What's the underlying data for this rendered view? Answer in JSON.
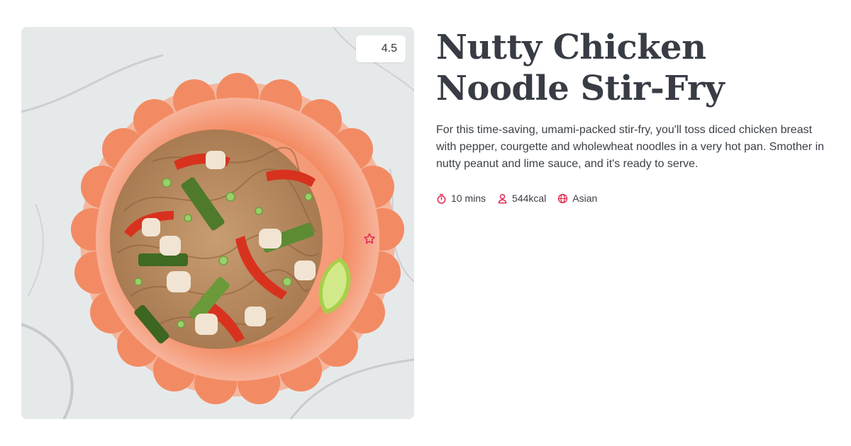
{
  "recipe": {
    "title": "Nutty Chicken Noodle Stir-Fry",
    "description": "For this time-saving, umami-packed stir-fry, you'll toss diced chicken breast with pepper, courgette and wholewheat noodles in a very hot pan. Smother in nutty peanut and lime sauce, and it's ready to serve.",
    "rating": "4.5",
    "rating_icon": "star-icon",
    "meta": {
      "time": {
        "icon": "timer-icon",
        "label": "10 mins"
      },
      "calories": {
        "icon": "person-icon",
        "label": "544kcal"
      },
      "cuisine": {
        "icon": "globe-icon",
        "label": "Asian"
      }
    }
  },
  "colors": {
    "accent": "#e0284f",
    "title": "#383c44",
    "text": "#3b3f46",
    "plate": "#f2875e"
  }
}
